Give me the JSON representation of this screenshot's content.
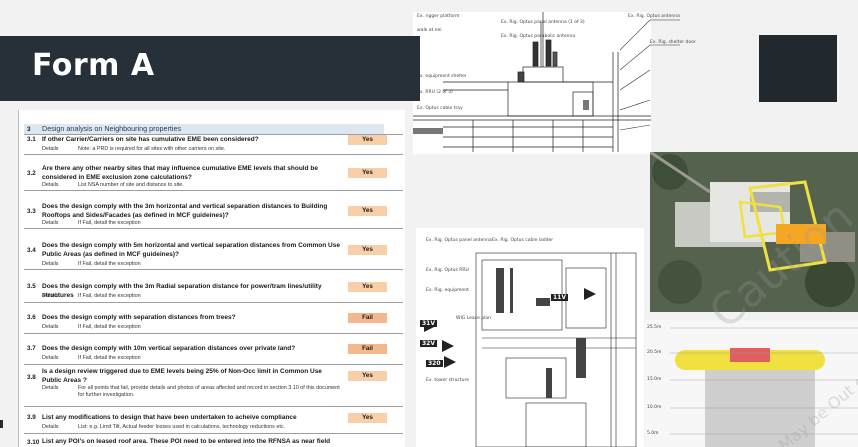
{
  "slide_title": "Form A",
  "form": {
    "section_number": "3",
    "section_title": "Design analysis on Neighbouring properties",
    "details_label": "Details",
    "rows": [
      {
        "num": "3.1",
        "question": "If other Carrier/Carriers on site has cumulative EME been considered?",
        "answer": "Yes",
        "details": "Note: a PRD is required for all sites with other carriers on site."
      },
      {
        "num": "3.2",
        "question": "Are there any other nearby sites that may influence cumulative EME levels that should be considered in EME exclusion zone calculations?",
        "answer": "Yes",
        "details": "List NSA number of site and distance to site."
      },
      {
        "num": "3.3",
        "question": "Does the design comply with the 3m horizontal and vertical separation distances to Building Rooftops and Sides/Facades (as defined in MCF guideines)?",
        "answer": "Yes",
        "details": "If Fail, detail the exception"
      },
      {
        "num": "3.4",
        "question": "Does the design comply with 5m horizontal and vertical separation distances from Common Use Public Areas  (as defined in MCF guideines)?",
        "answer": "Yes",
        "details": "If Fail, detail the exception"
      },
      {
        "num": "3.5",
        "question": "Does the design comply with the 3m Radial separation distance for power/tram lines/utility structures",
        "answer": "Yes",
        "details": "If Fail, detail the exception"
      },
      {
        "num": "3.6",
        "question": "Does the design comply with separation distances from trees?",
        "answer": "Fail",
        "details": "If Fail, detail the exception"
      },
      {
        "num": "3.7",
        "question": "Does the design comply with 10m vertical separation distances over private land?",
        "answer": "Fail",
        "details": "If Fail, detail the exception"
      },
      {
        "num": "3.8",
        "question": "Is a design review triggered due to EME levels being 25% of Non-Occ limit in Common Use Public Areas ?",
        "answer": "Yes",
        "details": "For all points that fail, provide details and photos of areas affected and record in section 3.10 of this document for further investigation."
      },
      {
        "num": "3.9",
        "question": "List any modifications to design that have been undertaken to acheive compliance",
        "answer": "Yes",
        "details": "List: e.g. Limit Tilt, Actual feeder losses used in calculations, technology reductions etc."
      },
      {
        "num": "3.10",
        "question": "List any POI's on leased roof area. These POI need to be entered into the RFNSA as near field",
        "answer": "",
        "details": ""
      }
    ]
  },
  "drawing_top_notes": [
    "Ex. rigger platform",
    "walk at nei",
    "Ex. Rig. Optus panel antenna (1 of 3)",
    "Ex. Rig. Optus parabolic antenna",
    "Ex. Rig. Optus antenna",
    "Ex. equipment shelter",
    "Ex. RRU (2 of 3)",
    "Ex. Optus cable tray",
    "Ex. Rig. shelter door"
  ],
  "drawing_bottom_notes": [
    "Ex. Rig. Optus panel antenna",
    "Ex. Rig. Optus cable ladder",
    "Ex. Rig. Optus RRU",
    "Ex. Rig. equipment",
    "WIG Lease plan",
    "Ex. tower structure"
  ],
  "drawing_bottom_markers": [
    "11V",
    "31V",
    "32V",
    "320"
  ],
  "elevation_labels": [
    "25.5m",
    "20.5m",
    "15.0m",
    "10.0m",
    "5.0m"
  ],
  "watermark": "Caution",
  "watermark_small": "May be Out of Date",
  "colors": {
    "banner": "#263038",
    "answer_yes": "#f8cfa8",
    "answer_fail": "#f5b88c",
    "highlight": "#f5a623",
    "zone": "#f0e040"
  }
}
